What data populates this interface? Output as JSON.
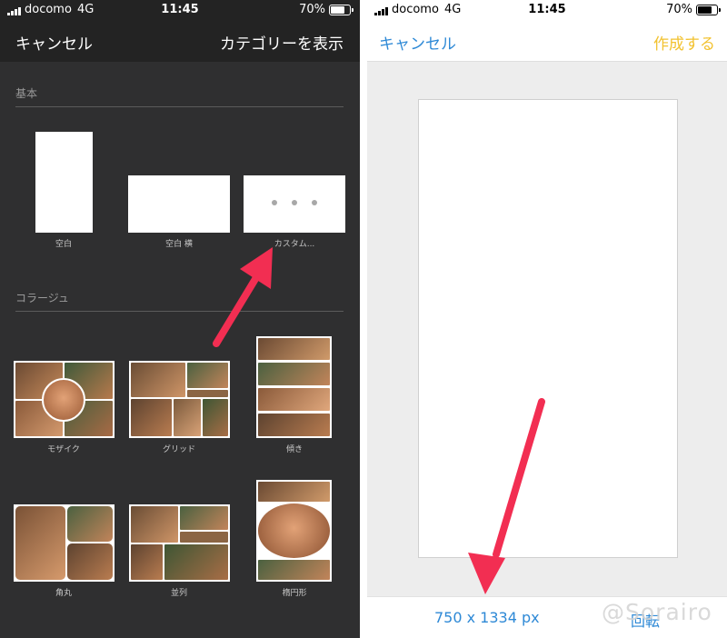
{
  "left": {
    "status": {
      "carrier": "docomo",
      "network": "4G",
      "time": "11:45",
      "battery": "70%",
      "battery_level": 0.7
    },
    "nav": {
      "cancel": "キャンセル",
      "show_categories": "カテゴリーを表示"
    },
    "sections": {
      "basic": {
        "title": "基本",
        "items": [
          {
            "label": "空白"
          },
          {
            "label": "空白 横"
          },
          {
            "label": "カスタム..."
          }
        ]
      },
      "collage": {
        "title": "コラージュ",
        "items": [
          {
            "label": "モザイク"
          },
          {
            "label": "グリッド"
          },
          {
            "label": "傾き"
          },
          {
            "label": "角丸"
          },
          {
            "label": "並列"
          },
          {
            "label": "楕円形"
          }
        ]
      }
    }
  },
  "right": {
    "status": {
      "carrier": "docomo",
      "network": "4G",
      "time": "11:45",
      "battery": "70%",
      "battery_level": 0.7
    },
    "nav": {
      "cancel": "キャンセル",
      "create": "作成する"
    },
    "bottom": {
      "size": "750 x 1334 px",
      "rotate": "回転"
    },
    "watermark": "@Sorairo"
  },
  "colors": {
    "dark_bg": "#2f2f30",
    "accent_blue": "#2e89d6",
    "accent_yellow": "#f2c230",
    "arrow_red": "#f22e52"
  },
  "icons": [
    "signal-icon",
    "battery-icon",
    "more-dots-icon",
    "arrow-annotation"
  ]
}
